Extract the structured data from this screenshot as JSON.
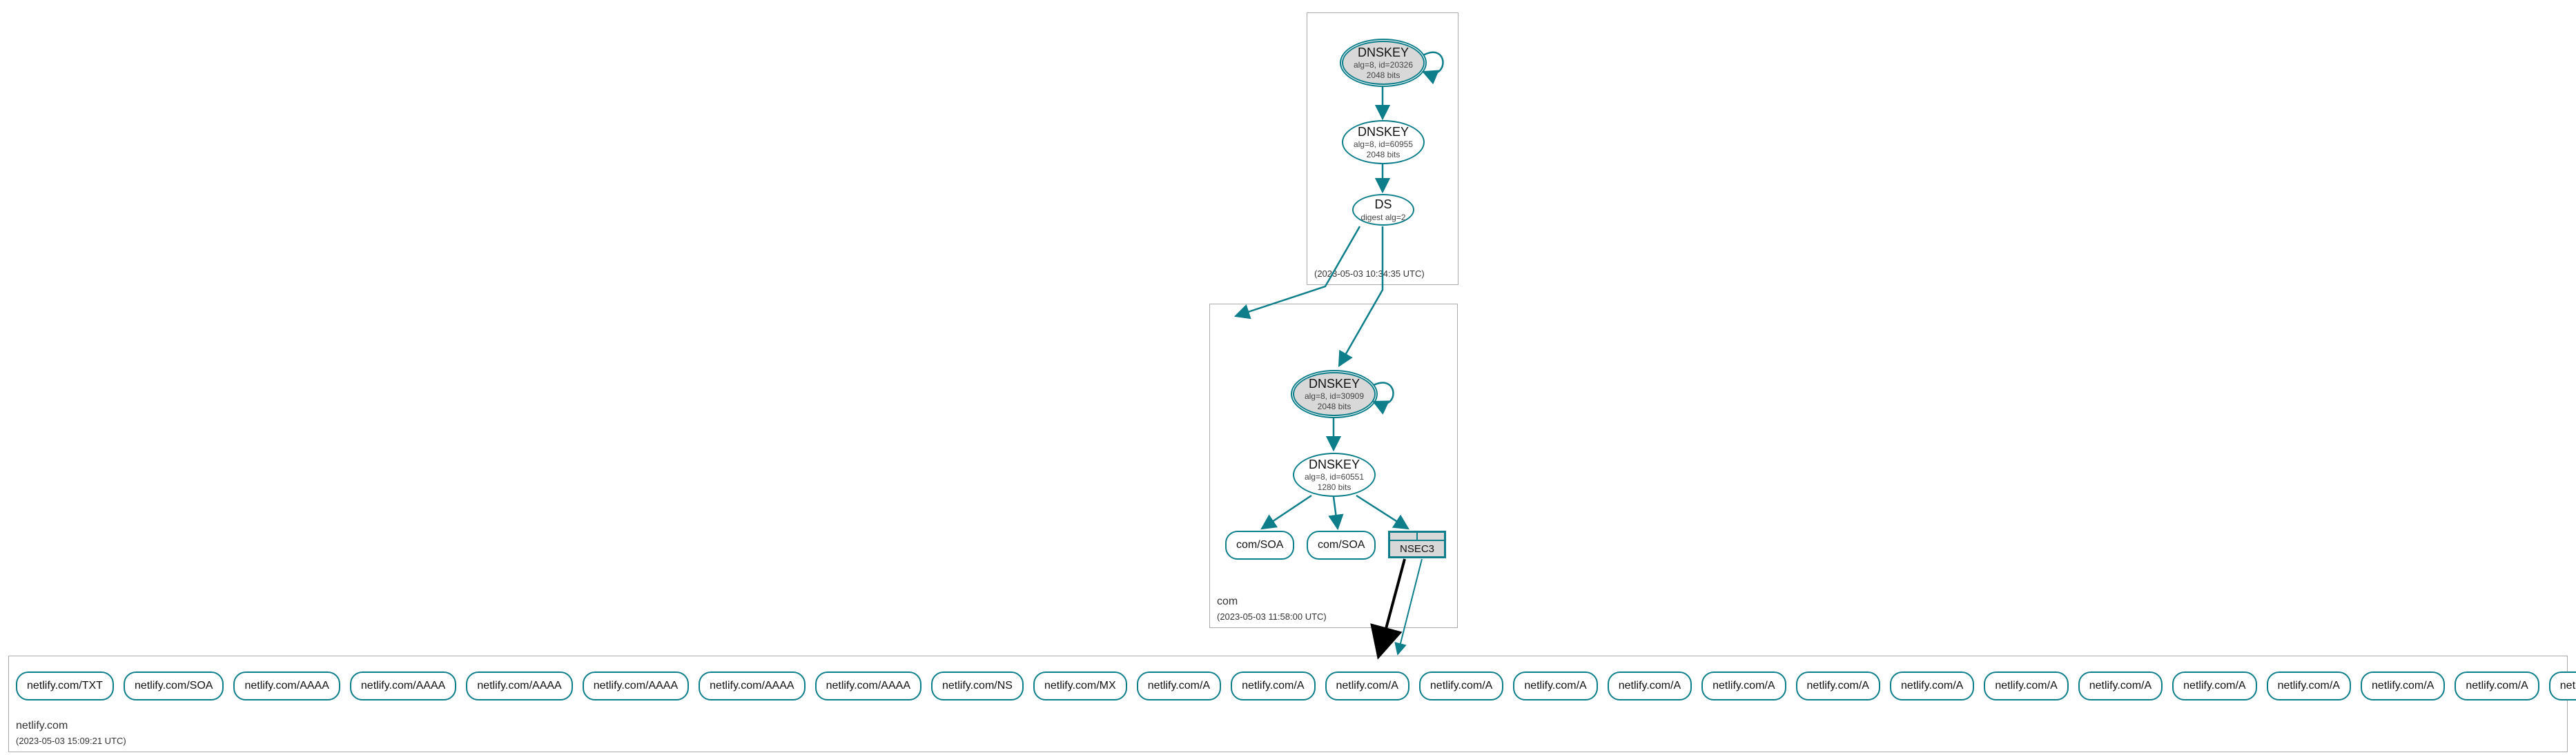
{
  "zones": {
    "root": {
      "label": ".",
      "timestamp": "(2023-05-03 10:34:35 UTC)",
      "ksk": {
        "title": "DNSKEY",
        "alg": "alg=8, id=20326",
        "bits": "2048 bits"
      },
      "zsk": {
        "title": "DNSKEY",
        "alg": "alg=8, id=60955",
        "bits": "2048 bits"
      },
      "ds": {
        "title": "DS",
        "alg": "digest alg=2"
      }
    },
    "com": {
      "label": "com",
      "timestamp": "(2023-05-03 11:58:00 UTC)",
      "ksk": {
        "title": "DNSKEY",
        "alg": "alg=8, id=30909",
        "bits": "2048 bits"
      },
      "zsk": {
        "title": "DNSKEY",
        "alg": "alg=8, id=60551",
        "bits": "1280 bits"
      },
      "soa1": "com/SOA",
      "soa2": "com/SOA",
      "nsec3": "NSEC3"
    },
    "netlify": {
      "label": "netlify.com",
      "timestamp": "(2023-05-03 15:09:21 UTC)",
      "records": [
        "netlify.com/TXT",
        "netlify.com/SOA",
        "netlify.com/AAAA",
        "netlify.com/AAAA",
        "netlify.com/AAAA",
        "netlify.com/AAAA",
        "netlify.com/AAAA",
        "netlify.com/AAAA",
        "netlify.com/NS",
        "netlify.com/MX",
        "netlify.com/A",
        "netlify.com/A",
        "netlify.com/A",
        "netlify.com/A",
        "netlify.com/A",
        "netlify.com/A",
        "netlify.com/A",
        "netlify.com/A",
        "netlify.com/A",
        "netlify.com/A",
        "netlify.com/A",
        "netlify.com/A",
        "netlify.com/A",
        "netlify.com/A",
        "netlify.com/A",
        "netlify.com/A"
      ]
    }
  }
}
